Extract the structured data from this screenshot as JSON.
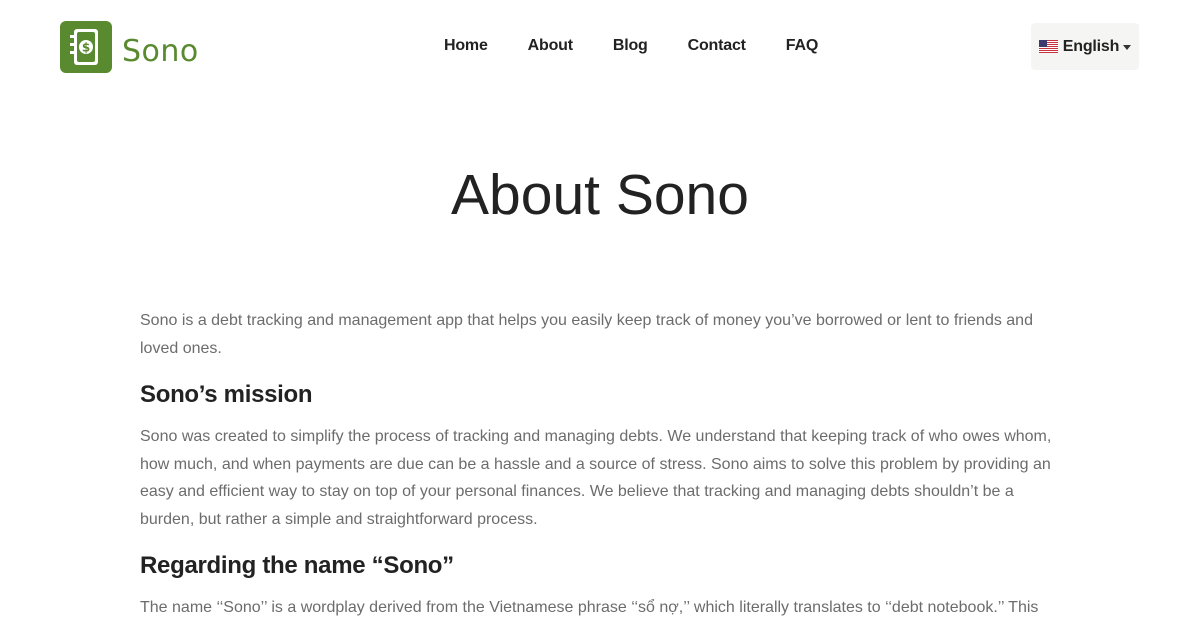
{
  "brand": {
    "name": "Sono",
    "logo_icon": "notebook-dollar-icon",
    "color": "#5a8a2f"
  },
  "nav": {
    "items": [
      {
        "label": "Home"
      },
      {
        "label": "About"
      },
      {
        "label": "Blog"
      },
      {
        "label": "Contact"
      },
      {
        "label": "FAQ"
      }
    ],
    "language": {
      "flag_icon": "us-flag-icon",
      "label": "English",
      "caret_icon": "caret-down-icon"
    }
  },
  "page": {
    "title": "About Sono",
    "intro": "Sono is a debt tracking and management app that helps you easily keep track of money you’ve borrowed or lent to friends and loved ones.",
    "sections": [
      {
        "heading": "Sono’s mission",
        "text": "Sono was created to simplify the process of tracking and managing debts. We understand that keeping track of who owes whom, how much, and when payments are due can be a hassle and a source of stress. Sono aims to solve this problem by providing an easy and efficient way to stay on top of your personal finances. We believe that tracking and managing debts shouldn’t be a burden, but rather a simple and straightforward process."
      },
      {
        "heading": "Regarding the name “Sono”",
        "text": "The name ‘‘Sono’’ is a wordplay derived from the Vietnamese phrase ‘‘sổ nợ,’’ which literally translates to ‘‘debt notebook.’’ This"
      }
    ]
  }
}
